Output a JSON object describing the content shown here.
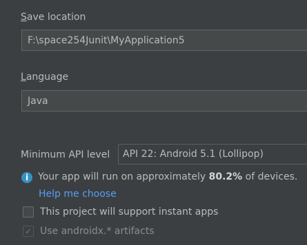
{
  "save_location": {
    "label": "Save location",
    "value": "F:\\space254Junit\\MyApplication5"
  },
  "language": {
    "label": "Language",
    "value": "Java"
  },
  "min_api": {
    "label": "Minimum API level",
    "value": "API 22: Android 5.1 (Lollipop)"
  },
  "info": {
    "icon": "i",
    "text_before": "Your app will run on approximately ",
    "percentage": "80.2%",
    "text_after": " of devices.",
    "help_link": "Help me choose"
  },
  "instant_apps": {
    "label": "This project will support instant apps",
    "checked": false
  },
  "androidx": {
    "label": "Use androidx.* artifacts",
    "checked": true,
    "check_glyph": "✓"
  },
  "colors": {
    "background": "#3c3f41",
    "text": "#bbbbbb",
    "link": "#589df6",
    "info_icon": "#3592c4"
  }
}
